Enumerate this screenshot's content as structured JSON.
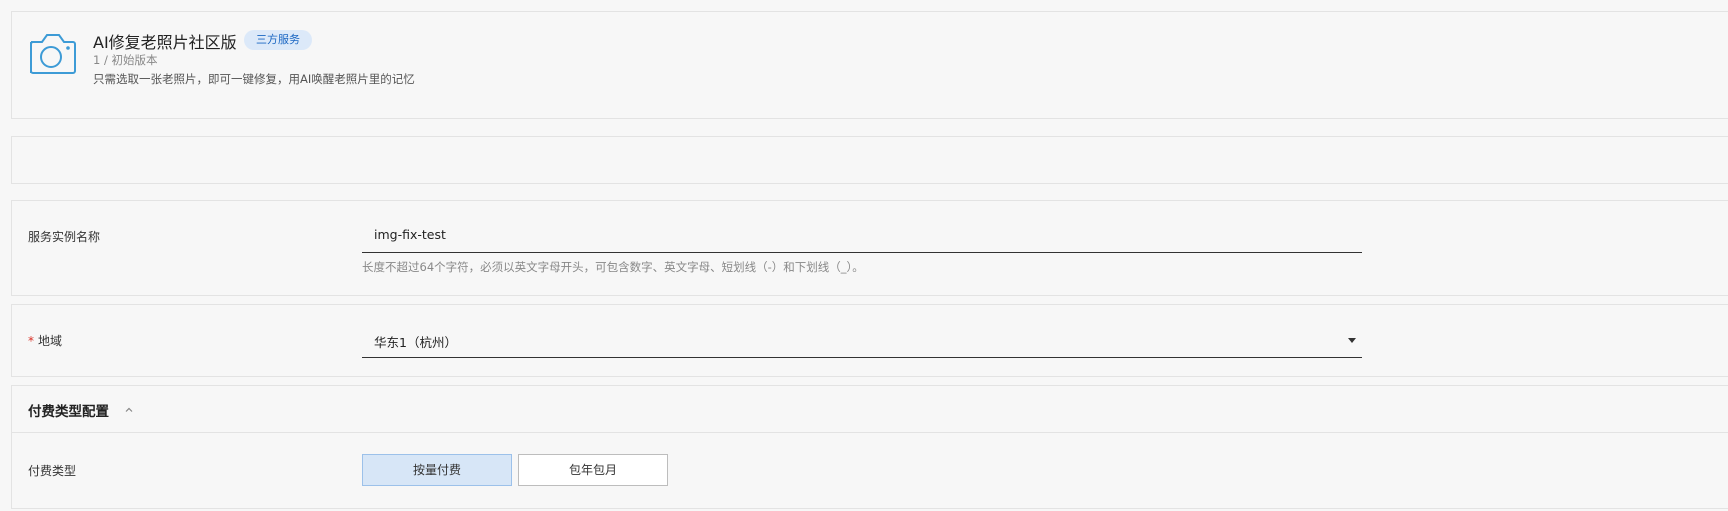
{
  "header": {
    "title": "AI修复老照片社区版",
    "badge": "三方服务",
    "version": "1 / 初始版本",
    "description": "只需选取一张老照片，即可一键修复，用AI唤醒老照片里的记忆",
    "icon": "camera-icon",
    "accent_color": "#3d9bd6"
  },
  "instance_name": {
    "label": "服务实例名称",
    "value": "img-fix-test",
    "hint": "长度不超过64个字符，必须以英文字母开头，可包含数字、英文字母、短划线（-）和下划线（_）。"
  },
  "region": {
    "required_mark": "*",
    "label": "地域",
    "selected": "华东1（杭州）"
  },
  "billing": {
    "section_title": "付费类型配置",
    "label": "付费类型",
    "options": [
      "按量付费",
      "包年包月"
    ],
    "selected_index": 0
  }
}
